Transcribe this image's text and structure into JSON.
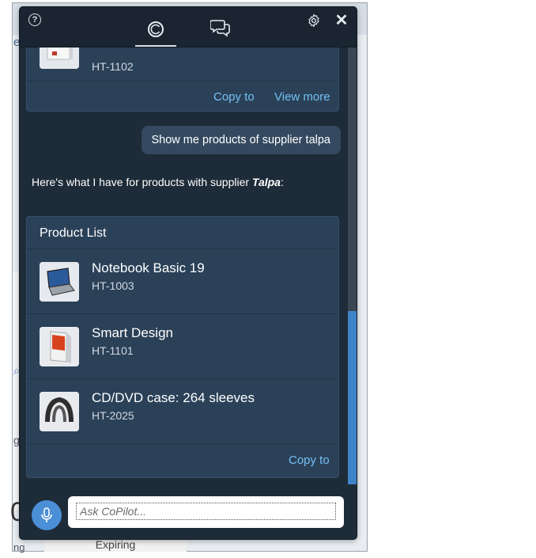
{
  "background": {
    "fragments": [
      "e",
      "g",
      "0",
      "ng"
    ],
    "bottom_cell": "Expiring"
  },
  "header": {
    "help_glyph": "?",
    "close_glyph": "✕",
    "tabs": [
      {
        "name": "copilot",
        "icon": "copilot-icon",
        "active": true
      },
      {
        "name": "chat",
        "icon": "chat-bubbles-icon",
        "active": false
      }
    ]
  },
  "previous_card": {
    "product_id": "HT-1102",
    "actions": [
      "Copy to",
      "View more"
    ]
  },
  "user_message": "Show me products of supplier talpa",
  "bot_message": {
    "text_before": "Here's what I have for products with supplier ",
    "emphasis": "Talpa",
    "text_after": ":"
  },
  "product_list": {
    "title": "Product List",
    "items": [
      {
        "name": "Notebook Basic 19",
        "id": "HT-1003",
        "thumb": "laptop"
      },
      {
        "name": "Smart Design",
        "id": "HT-1101",
        "thumb": "software-box"
      },
      {
        "name": "CD/DVD case: 264 sleeves",
        "id": "HT-2025",
        "thumb": "case"
      }
    ],
    "action": "Copy to"
  },
  "input": {
    "placeholder": "Ask CoPilot...",
    "value": ""
  },
  "colors": {
    "panel_bg": "#1e2b38",
    "card_bg": "#2b4158",
    "link": "#74c0f5",
    "accent": "#4b8fd6"
  }
}
